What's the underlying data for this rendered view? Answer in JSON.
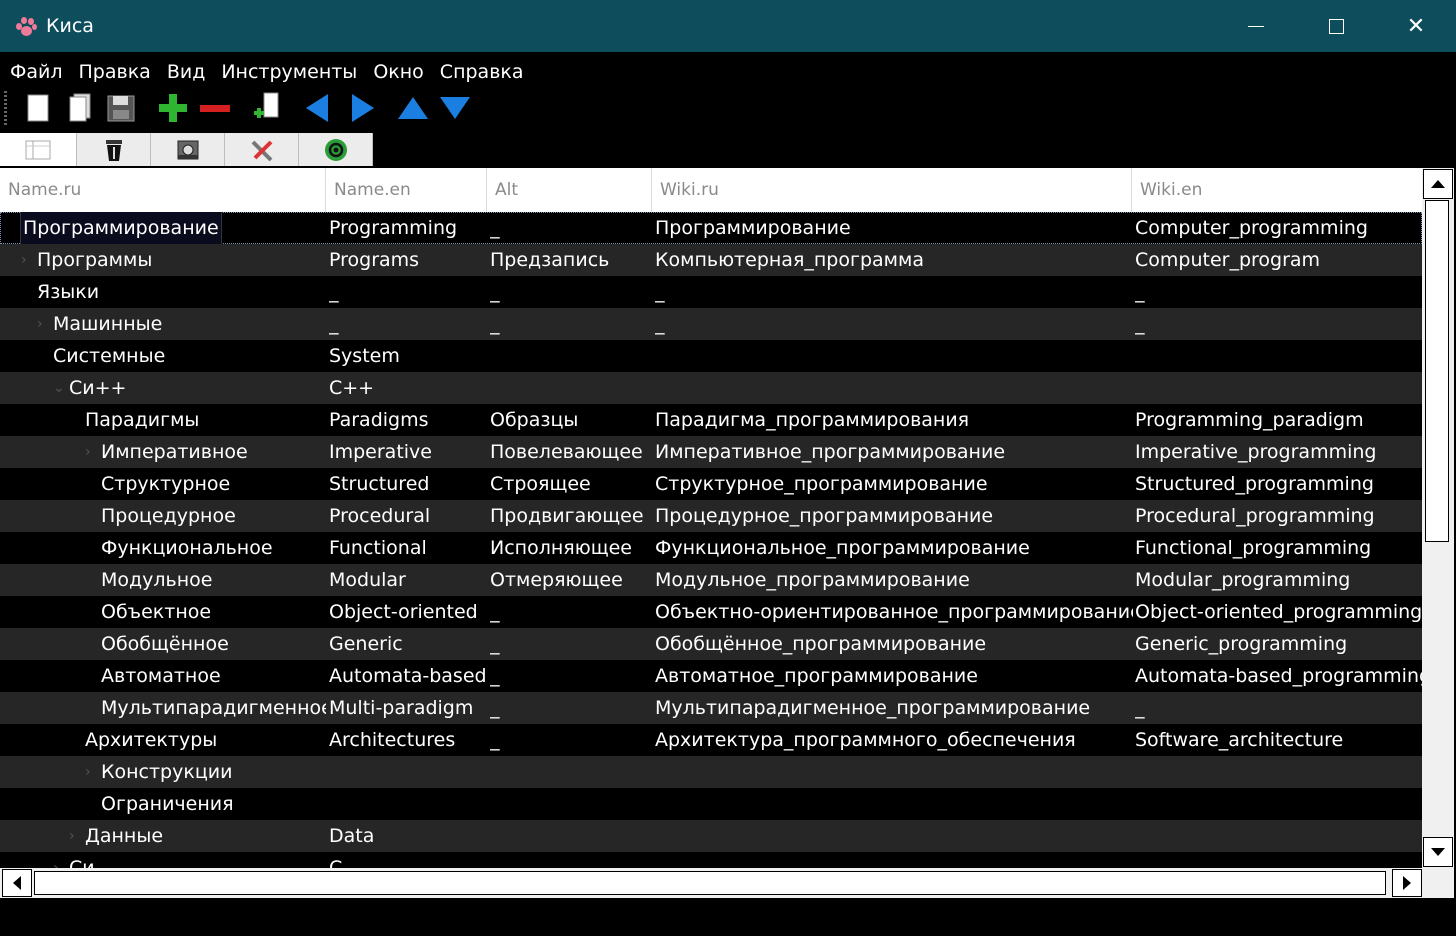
{
  "window": {
    "title": "Киса"
  },
  "menu": [
    "Файл",
    "Правка",
    "Вид",
    "Инструменты",
    "Окно",
    "Справка"
  ],
  "toolbar": [
    "new-document-icon",
    "open-document-icon",
    "save-icon",
    "add-icon",
    "remove-icon",
    "import-icon",
    "back-arrow-icon",
    "forward-arrow-icon",
    "up-arrow-icon",
    "down-arrow-icon"
  ],
  "tabs": [
    "list-view-icon",
    "trash-icon",
    "database-icon",
    "tools-icon",
    "email-icon"
  ],
  "columns": [
    "Name.ru",
    "Name.en",
    "Alt",
    "Wiki.ru",
    "Wiki.en"
  ],
  "rows": [
    {
      "name": "Программирование",
      "name_en": "Programming",
      "alt": "_",
      "wiki_ru": "Программирование",
      "wiki_en": "Computer_programming",
      "level": 0,
      "expander": "",
      "selected": true
    },
    {
      "name": "Программы",
      "name_en": "Programs",
      "alt": "Предзапись",
      "wiki_ru": "Компьютерная_программа",
      "wiki_en": "Computer_program",
      "level": 1,
      "expander": "›"
    },
    {
      "name": "Языки",
      "name_en": "_",
      "alt": "_",
      "wiki_ru": "_",
      "wiki_en": "_",
      "level": 1,
      "expander": ""
    },
    {
      "name": "Машинные",
      "name_en": "_",
      "alt": "_",
      "wiki_ru": "_",
      "wiki_en": "_",
      "level": 2,
      "expander": "›"
    },
    {
      "name": "Системные",
      "name_en": "System",
      "alt": "",
      "wiki_ru": "",
      "wiki_en": "",
      "level": 2,
      "expander": ""
    },
    {
      "name": "Си++",
      "name_en": "C++",
      "alt": "",
      "wiki_ru": "",
      "wiki_en": "",
      "level": 3,
      "expander": "⌄"
    },
    {
      "name": "Парадигмы",
      "name_en": "Paradigms",
      "alt": "Образцы",
      "wiki_ru": "Парадигма_программирования",
      "wiki_en": "Programming_paradigm",
      "level": 4,
      "expander": ""
    },
    {
      "name": "Императивное",
      "name_en": "Imperative",
      "alt": "Повелевающее",
      "wiki_ru": "Императивное_программирование",
      "wiki_en": "Imperative_programming",
      "level": 5,
      "expander": "›"
    },
    {
      "name": "Структурное",
      "name_en": "Structured",
      "alt": "Строящее",
      "wiki_ru": "Структурное_программирование",
      "wiki_en": "Structured_programming",
      "level": 5,
      "expander": ""
    },
    {
      "name": "Процедурное",
      "name_en": "Procedural",
      "alt": "Продвигающее",
      "wiki_ru": "Процедурное_программирование",
      "wiki_en": "Procedural_programming",
      "level": 5,
      "expander": ""
    },
    {
      "name": "Функциональное",
      "name_en": "Functional",
      "alt": "Исполняющее",
      "wiki_ru": "Функциональное_программирование",
      "wiki_en": "Functional_programming",
      "level": 5,
      "expander": ""
    },
    {
      "name": "Модульное",
      "name_en": "Modular",
      "alt": "Отмеряющее",
      "wiki_ru": "Модульное_программирование",
      "wiki_en": "Modular_programming",
      "level": 5,
      "expander": ""
    },
    {
      "name": "Объектное",
      "name_en": "Object-oriented",
      "alt": "_",
      "wiki_ru": "Объектно-ориентированное_программирование",
      "wiki_en": "Object-oriented_programming",
      "level": 5,
      "expander": ""
    },
    {
      "name": "Обобщённое",
      "name_en": "Generic",
      "alt": "_",
      "wiki_ru": "Обобщённое_программирование",
      "wiki_en": "Generic_programming",
      "level": 5,
      "expander": ""
    },
    {
      "name": "Автоматное",
      "name_en": "Automata-based",
      "alt": "_",
      "wiki_ru": "Автоматное_программирование",
      "wiki_en": "Automata-based_programming",
      "level": 5,
      "expander": ""
    },
    {
      "name": "Мультипарадигменное",
      "name_en": "Multi-paradigm",
      "alt": "_",
      "wiki_ru": "Мультипарадигменное_программирование",
      "wiki_en": "_",
      "level": 5,
      "expander": ""
    },
    {
      "name": "Архитектуры",
      "name_en": "Architectures",
      "alt": "_",
      "wiki_ru": "Архитектура_программного_обеспечения",
      "wiki_en": "Software_architecture",
      "level": 4,
      "expander": ""
    },
    {
      "name": "Конструкции",
      "name_en": "",
      "alt": "",
      "wiki_ru": "",
      "wiki_en": "",
      "level": 5,
      "expander": "›"
    },
    {
      "name": "Ограничения",
      "name_en": "",
      "alt": "",
      "wiki_ru": "",
      "wiki_en": "",
      "level": 5,
      "expander": ""
    },
    {
      "name": "Данные",
      "name_en": "Data",
      "alt": "",
      "wiki_ru": "",
      "wiki_en": "",
      "level": 4,
      "expander": "›"
    },
    {
      "name": "Си",
      "name_en": "C",
      "alt": "",
      "wiki_ru": "",
      "wiki_en": "",
      "level": 3,
      "expander": "›"
    }
  ]
}
